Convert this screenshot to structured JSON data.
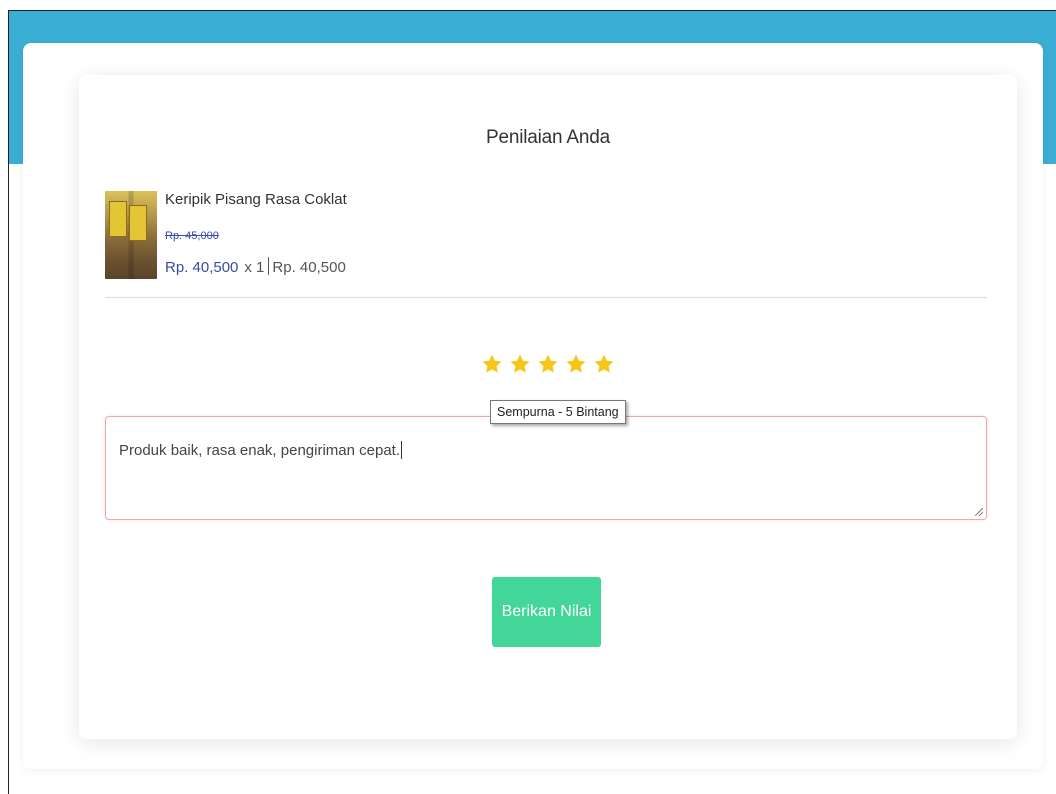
{
  "colors": {
    "header_band": "#3aaed4",
    "price": "#3b4aa8",
    "star": "#f5c518",
    "button": "#42d699",
    "textarea_border": "#f3a8a8"
  },
  "review_form": {
    "title": "Penilaian Anda",
    "product": {
      "name": "Keripik Pisang Rasa Coklat",
      "image_icon": "product-thumbnail",
      "original_price": "Rp. 45,000",
      "price": "Rp. 40,500",
      "quantity": "x 1",
      "total": "Rp. 40,500"
    },
    "rating": {
      "value": 5,
      "max": 5,
      "tooltip": "Sempurna - 5 Bintang",
      "icon": "star-icon"
    },
    "review_text": "Produk baik, rasa enak, pengiriman cepat.",
    "submit_label": "Berikan Nilai"
  }
}
